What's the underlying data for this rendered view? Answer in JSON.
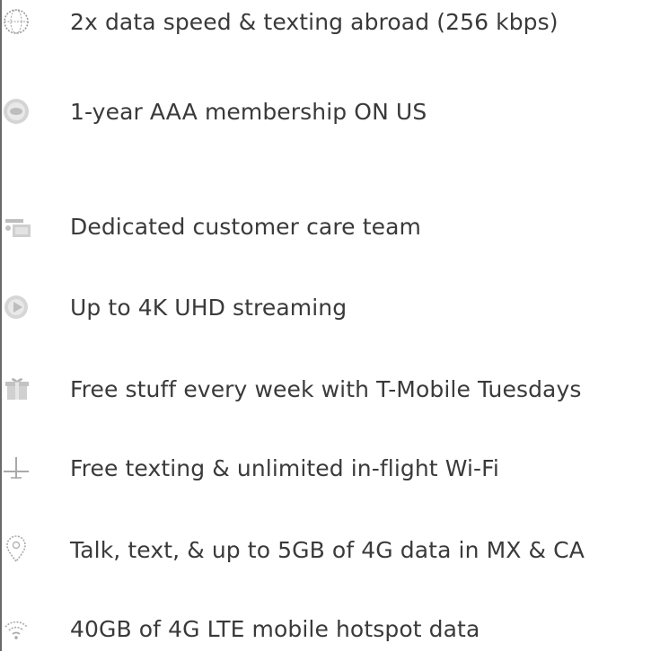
{
  "features": {
    "items": [
      {
        "label": "2x data speed & texting abroad (256 kbps)",
        "icon": "globe-icon"
      },
      {
        "label": "1-year AAA membership ON US",
        "icon": "aaa-badge-icon"
      },
      {
        "label": "Dedicated customer care team",
        "icon": "customer-care-icon"
      },
      {
        "label": "Up to 4K UHD streaming",
        "icon": "streaming-icon"
      },
      {
        "label": "Free stuff every week with T-Mobile Tuesdays",
        "icon": "gift-icon"
      },
      {
        "label": "Free texting & unlimited in-flight Wi-Fi",
        "icon": "airplane-icon"
      },
      {
        "label": "Talk, text, & up to 5GB of 4G data in MX & CA",
        "icon": "location-pin-icon"
      },
      {
        "label": "40GB of 4G LTE mobile hotspot data",
        "icon": "hotspot-icon"
      }
    ]
  },
  "colors": {
    "text": "#3a3a3a",
    "icon": "#9a9a9a",
    "border": "#6a6a6a"
  }
}
